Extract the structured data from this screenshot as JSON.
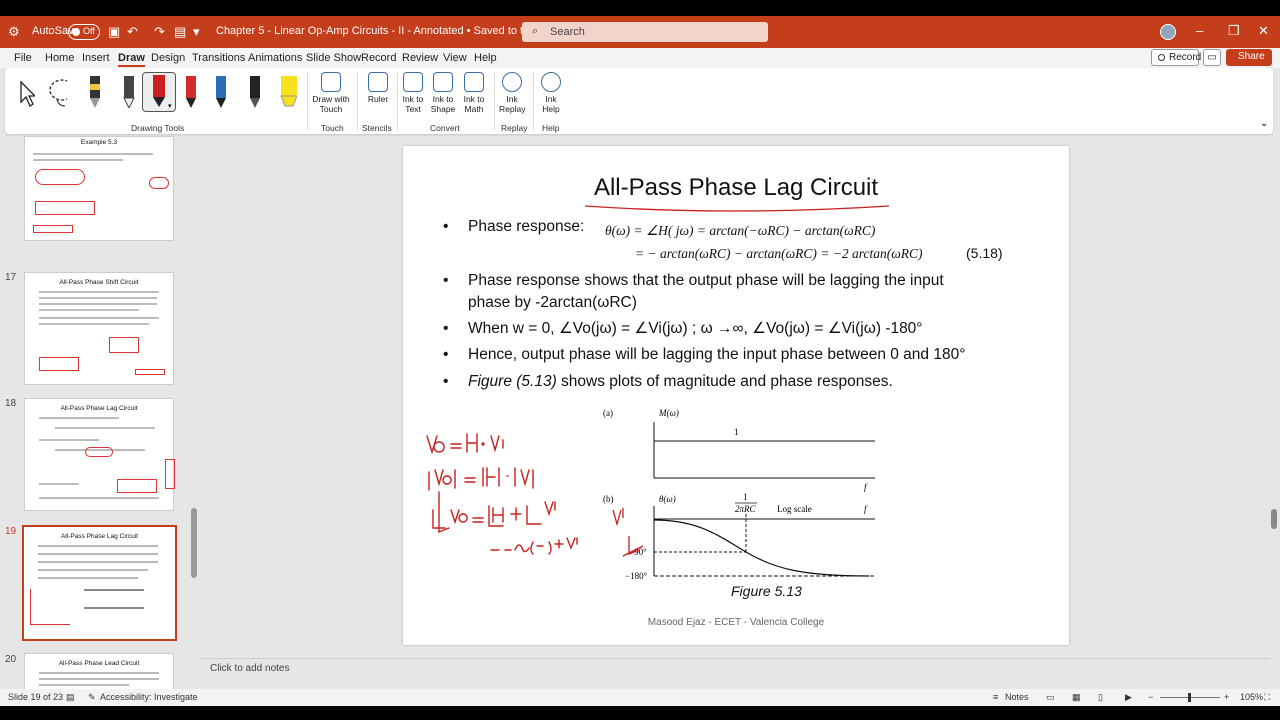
{
  "titlebar": {
    "autosave": "AutoSave",
    "toggle": "Off",
    "document": "Chapter 5 - Linear Op-Amp Circuits - II - Annotated • Saved to this PC",
    "search_placeholder": "Search"
  },
  "menu": {
    "items": [
      "File",
      "Home",
      "Insert",
      "Draw",
      "Design",
      "Transitions",
      "Animations",
      "Slide Show",
      "Record",
      "Review",
      "View",
      "Help"
    ],
    "active": "Draw",
    "record": "Record",
    "share": "Share"
  },
  "ribbon": {
    "drawing_tools": "Drawing Tools",
    "draw_touch": "Draw with Touch",
    "touch": "Touch",
    "ruler": "Ruler",
    "stencils": "Stencils",
    "ink_to_text": "Ink to Text",
    "ink_to_shape": "Ink to Shape",
    "ink_to_math": "Ink to Math",
    "convert": "Convert",
    "ink_replay": "Ink Replay",
    "replay": "Replay",
    "ink_help": "Ink Help",
    "help": "Help",
    "pen_colors": [
      "#333333",
      "#f4c542",
      "#ffffff",
      "#c8201d",
      "#d42a2a",
      "#2a6fb5",
      "#222222",
      "#f7e01c"
    ]
  },
  "thumbnails": [
    {
      "num": "",
      "title": "Example 5.3"
    },
    {
      "num": "17",
      "title": "All-Pass Phase Shift Circuit"
    },
    {
      "num": "18",
      "title": "All-Pass Phase Lag Circuit"
    },
    {
      "num": "19",
      "title": "All-Pass Phase Lag Circuit"
    },
    {
      "num": "20",
      "title": "All-Pass Phase Lead Circuit"
    }
  ],
  "slide": {
    "title": "All-Pass Phase Lag Circuit",
    "b1": "Phase response:",
    "eq1": "θ(ω) = ∠H( jω) = arctan(−ωRC) − arctan(ωRC)",
    "eq2": "= − arctan(ωRC) − arctan(ωRC) = −2 arctan(ωRC)",
    "eqnum": "(5.18)",
    "b2a": "Phase response shows that the output phase will be lagging the input",
    "b2b": "phase by -2arctan(ωRC)",
    "b3": "When w = 0, ∠Vo(jω) = ∠Vi(jω) ; ω →∞, ∠Vo(jω) = ∠Vi(jω) -180°",
    "b4": "Hence, output phase will be lagging the input phase between 0 and 180°",
    "b5_italic": "Figure (5.13)",
    "b5_rest": " shows plots of magnitude and phase responses.",
    "fig": {
      "a": "(a)",
      "b": "(b)",
      "mw": "M(ω)",
      "one": "1",
      "f": "f",
      "tw": "θ(ω)",
      "frac_num": "1",
      "frac_den": "2πRC",
      "log": "Log scale",
      "m90": "−90°",
      "m180": "−180°"
    },
    "caption": "Figure 5.13",
    "footer": "Masood Ejaz - ECET - Valencia College"
  },
  "notes": "Click to add notes",
  "status": {
    "slide": "Slide 19 of 23",
    "accessibility": "Accessibility: Investigate",
    "notes": "Notes",
    "zoom": "105%"
  },
  "colors": {
    "accent": "#c43e1c",
    "ink": "#c8201d"
  }
}
